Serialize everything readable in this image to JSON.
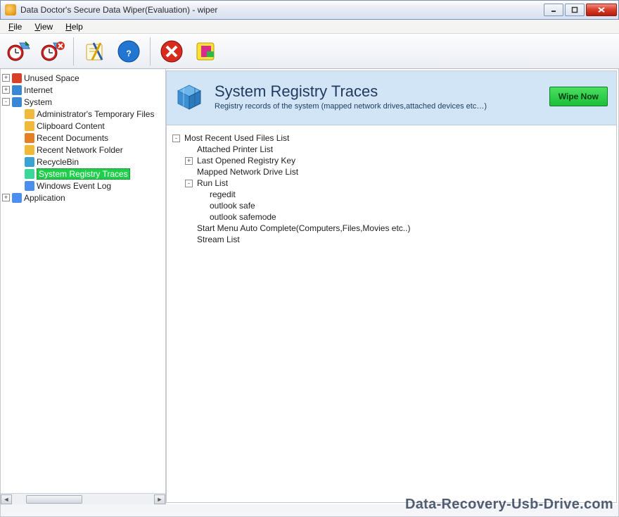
{
  "window": {
    "title": "Data Doctor's Secure Data Wiper(Evaluation) - wiper"
  },
  "menu": {
    "file": "File",
    "view": "View",
    "help": "Help"
  },
  "toolbar": {
    "open_scan": "open-scan-icon",
    "delete_scan": "delete-scan-icon",
    "settings": "settings-icon",
    "help": "help-icon",
    "stop": "stop-icon",
    "refresh": "refresh-icon"
  },
  "sidebar": {
    "items": [
      {
        "label": "Unused Space",
        "toggle": "+",
        "indent": 0,
        "icon": "#d94028"
      },
      {
        "label": "Internet",
        "toggle": "+",
        "indent": 0,
        "icon": "#3a87d6"
      },
      {
        "label": "System",
        "toggle": "-",
        "indent": 0,
        "icon": "#3a87d6"
      },
      {
        "label": "Administrator's Temporary Files",
        "toggle": "",
        "indent": 1,
        "icon": "#f0b93a"
      },
      {
        "label": "Clipboard Content",
        "toggle": "",
        "indent": 1,
        "icon": "#f0b93a"
      },
      {
        "label": "Recent Documents",
        "toggle": "",
        "indent": 1,
        "icon": "#e67e22"
      },
      {
        "label": "Recent Network Folder",
        "toggle": "",
        "indent": 1,
        "icon": "#f0b93a"
      },
      {
        "label": "RecycleBin",
        "toggle": "",
        "indent": 1,
        "icon": "#3aa3d6"
      },
      {
        "label": "System Registry Traces",
        "toggle": "",
        "indent": 1,
        "icon": "#3ad69a",
        "selected": true
      },
      {
        "label": "Windows Event Log",
        "toggle": "",
        "indent": 1,
        "icon": "#4a8ff0"
      },
      {
        "label": "Application",
        "toggle": "+",
        "indent": 0,
        "icon": "#4a8ff0"
      }
    ]
  },
  "header": {
    "title": "System Registry Traces",
    "subtitle": "Registry records of the system (mapped network drives,attached devices etc…)",
    "wipe": "Wipe Now"
  },
  "detail": {
    "items": [
      {
        "label": "Most Recent Used Files List",
        "toggle": "-",
        "indent": 0
      },
      {
        "label": "Attached Printer List",
        "toggle": "",
        "indent": 1
      },
      {
        "label": "Last Opened Registry Key",
        "toggle": "+",
        "indent": 1
      },
      {
        "label": "Mapped Network Drive List",
        "toggle": "",
        "indent": 1
      },
      {
        "label": "Run List",
        "toggle": "-",
        "indent": 1
      },
      {
        "label": "regedit",
        "toggle": "",
        "indent": 2
      },
      {
        "label": "outlook safe",
        "toggle": "",
        "indent": 2
      },
      {
        "label": "outlook safemode",
        "toggle": "",
        "indent": 2
      },
      {
        "label": "Start Menu Auto Complete(Computers,Files,Movies etc..)",
        "toggle": "",
        "indent": 1
      },
      {
        "label": "Stream List",
        "toggle": "",
        "indent": 1
      }
    ]
  },
  "watermark": "Data-Recovery-Usb-Drive.com"
}
